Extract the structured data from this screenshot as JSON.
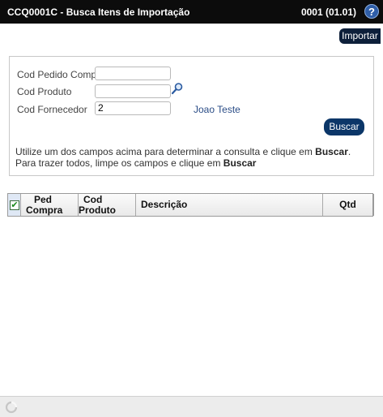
{
  "window": {
    "title": "CCQ0001C - Busca Itens de Importação",
    "version": "0001 (01.01)",
    "help_label": "?"
  },
  "toolbar": {
    "import_label": "Importar"
  },
  "form": {
    "pedido_label": "Cod Pedido Compra",
    "pedido_value": "",
    "produto_label": "Cod Produto",
    "produto_value": "",
    "fornecedor_label": "Cod Fornecedor",
    "fornecedor_value": "2",
    "fornecedor_name": "Joao Teste",
    "search_label": "Buscar",
    "info1_prefix": "Utilize um dos campos acima para determinar a consulta e clique em ",
    "info1_bold": "Buscar",
    "info1_suffix": ".",
    "info2_prefix": "Para trazer todos, limpe os campos e clique em ",
    "info2_bold": "Buscar"
  },
  "grid": {
    "columns": {
      "ped_line1": "Ped",
      "ped_line2": "Compra",
      "cod_line1": "Cod",
      "cod_line2": "Produto",
      "descricao": "Descrição",
      "qtd": "Qtd"
    },
    "select_all_checked": true,
    "select_all_glyph": "✔",
    "rows": []
  },
  "icons": {
    "help": "help-icon",
    "search": "magnifier-icon",
    "loading": "spinner-icon"
  }
}
